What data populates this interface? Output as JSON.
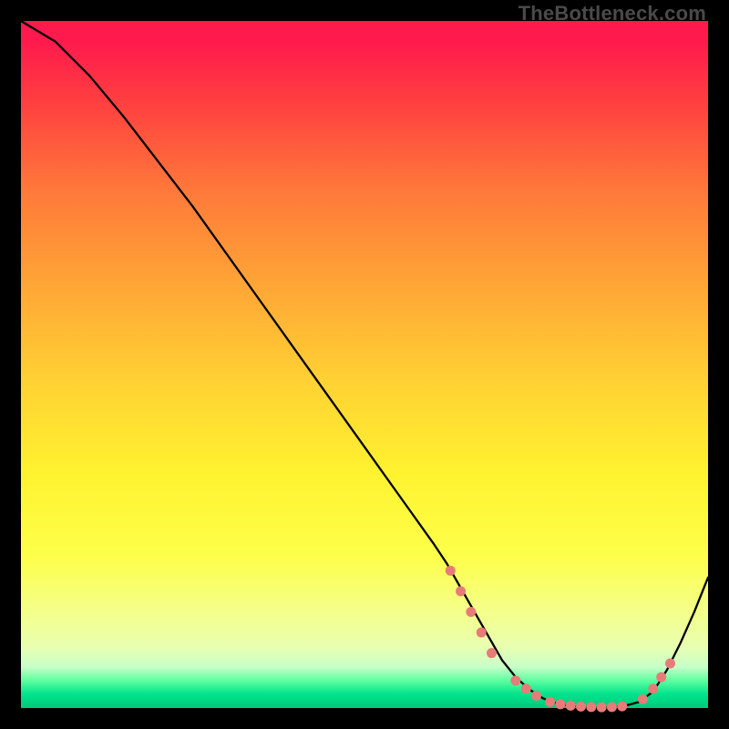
{
  "watermark": "TheBottleneck.com",
  "chart_data": {
    "type": "line",
    "title": "",
    "xlabel": "",
    "ylabel": "",
    "xlim": [
      0,
      100
    ],
    "ylim": [
      0,
      100
    ],
    "series": [
      {
        "name": "curve",
        "x": [
          0,
          5,
          10,
          15,
          20,
          25,
          30,
          35,
          40,
          45,
          50,
          55,
          60,
          62,
          64,
          66,
          68,
          70,
          72,
          74,
          76,
          78,
          80,
          82,
          84,
          86,
          88,
          90,
          92,
          94,
          96,
          98,
          100
        ],
        "y": [
          100,
          97,
          92,
          86,
          79.5,
          73,
          66,
          59,
          52,
          45,
          38,
          31,
          24,
          21,
          17.5,
          14,
          10.5,
          7,
          4.5,
          2.7,
          1.4,
          0.65,
          0.3,
          0.15,
          0.1,
          0.15,
          0.35,
          0.9,
          2.4,
          5.5,
          9.5,
          14,
          19
        ]
      }
    ],
    "markers": {
      "name": "dots",
      "color": "#e77b77",
      "points": [
        {
          "x": 62.5,
          "y": 20
        },
        {
          "x": 64.0,
          "y": 17
        },
        {
          "x": 65.5,
          "y": 14
        },
        {
          "x": 67.0,
          "y": 11
        },
        {
          "x": 68.5,
          "y": 8
        },
        {
          "x": 72.0,
          "y": 4
        },
        {
          "x": 73.5,
          "y": 2.8
        },
        {
          "x": 75.0,
          "y": 1.8
        },
        {
          "x": 77.0,
          "y": 0.9
        },
        {
          "x": 78.5,
          "y": 0.55
        },
        {
          "x": 80.0,
          "y": 0.35
        },
        {
          "x": 81.5,
          "y": 0.22
        },
        {
          "x": 83.0,
          "y": 0.15
        },
        {
          "x": 84.5,
          "y": 0.12
        },
        {
          "x": 86.0,
          "y": 0.15
        },
        {
          "x": 87.5,
          "y": 0.25
        },
        {
          "x": 90.5,
          "y": 1.3
        },
        {
          "x": 92.0,
          "y": 2.8
        },
        {
          "x": 93.2,
          "y": 4.5
        },
        {
          "x": 94.5,
          "y": 6.5
        }
      ]
    }
  }
}
